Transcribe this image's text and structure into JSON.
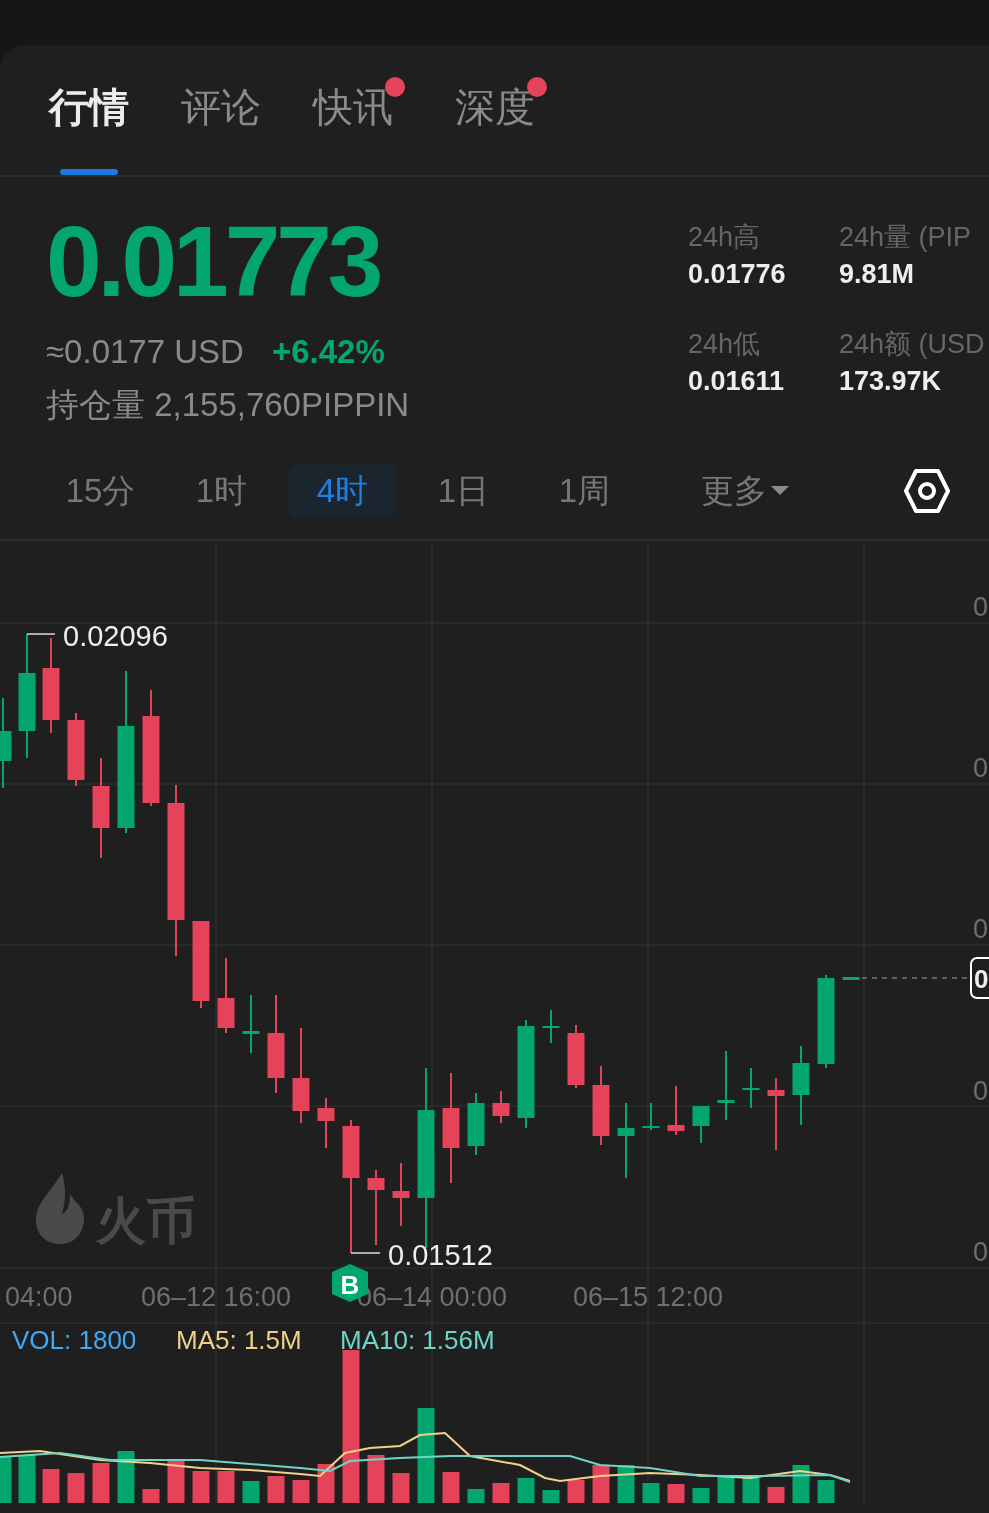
{
  "tabs": [
    {
      "label": "行情",
      "selected": true,
      "badge": false
    },
    {
      "label": "评论",
      "selected": false,
      "badge": false
    },
    {
      "label": "快讯",
      "selected": false,
      "badge": true
    },
    {
      "label": "深度",
      "selected": false,
      "badge": true
    }
  ],
  "price": {
    "last": "0.01773",
    "usd": "≈0.0177 USD",
    "change": "+6.42%",
    "open_interest": "持仓量 2,155,760PIPPIN"
  },
  "stats": [
    {
      "label": "24h高",
      "value": "0.01776"
    },
    {
      "label": "24h量 (PIP",
      "value": "9.81M"
    },
    {
      "label": "24h低",
      "value": "0.01611"
    },
    {
      "label": "24h额 (USD",
      "value": "173.97K"
    }
  ],
  "intervals": [
    {
      "label": "15分",
      "selected": false,
      "kind": "interval"
    },
    {
      "label": "1时",
      "selected": false,
      "kind": "interval"
    },
    {
      "label": "4时",
      "selected": true,
      "kind": "interval"
    },
    {
      "label": "1日",
      "selected": false,
      "kind": "interval"
    },
    {
      "label": "1周",
      "selected": false,
      "kind": "interval"
    },
    {
      "label": "更多",
      "selected": false,
      "kind": "menu"
    }
  ],
  "chart": {
    "watermark": "火币",
    "high_label": "0.02096",
    "low_label": "0.01512",
    "current_price_tag": "0",
    "price_axis": [
      "0",
      "0",
      "0",
      "0",
      "0"
    ],
    "time_axis": [
      "04:00",
      "06–12 16:00",
      "06–14 00:00",
      "06–15 12:00"
    ],
    "marker": "B"
  },
  "volume": {
    "vol": "VOL: 1800",
    "ma5": "MA5: 1.5M",
    "ma10": "MA10: 1.56M"
  }
}
